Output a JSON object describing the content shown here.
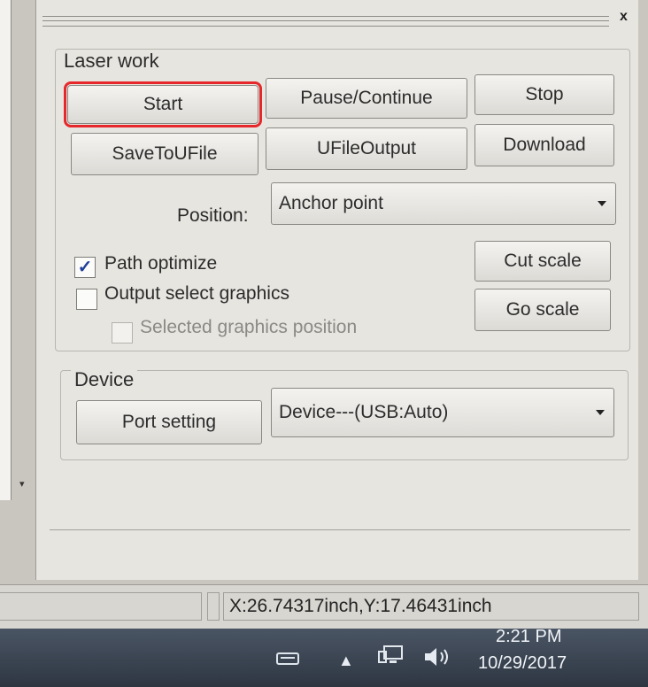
{
  "window": {
    "close_label": "x"
  },
  "laser_work": {
    "title": "Laser work",
    "buttons": {
      "start": "Start",
      "pause_continue": "Pause/Continue",
      "stop": "Stop",
      "save_to_ufile": "SaveToUFile",
      "ufile_output": "UFileOutput",
      "download": "Download",
      "cut_scale": "Cut scale",
      "go_scale": "Go scale"
    },
    "position": {
      "label": "Position:",
      "value": "Anchor point"
    },
    "options": {
      "path_optimize": {
        "label": "Path optimize",
        "checked": true
      },
      "output_select_graphics": {
        "label": "Output select graphics",
        "checked": false
      },
      "selected_graphics_position": {
        "label": "Selected graphics position",
        "checked": false,
        "enabled": false
      }
    }
  },
  "device": {
    "title": "Device",
    "port_setting": "Port setting",
    "device_value": "Device---(USB:Auto)"
  },
  "status_bar": {
    "coords": "X:26.74317inch,Y:17.46431inch"
  },
  "taskbar": {
    "time": "2:21 PM",
    "date": "10/29/2017",
    "icons": [
      "keyboard-icon",
      "show-hidden-icons-arrow",
      "network-icon",
      "volume-icon"
    ]
  },
  "colors": {
    "highlight": "#e6282b",
    "check": "#1f3f9a",
    "taskbar": "#3a4452"
  }
}
